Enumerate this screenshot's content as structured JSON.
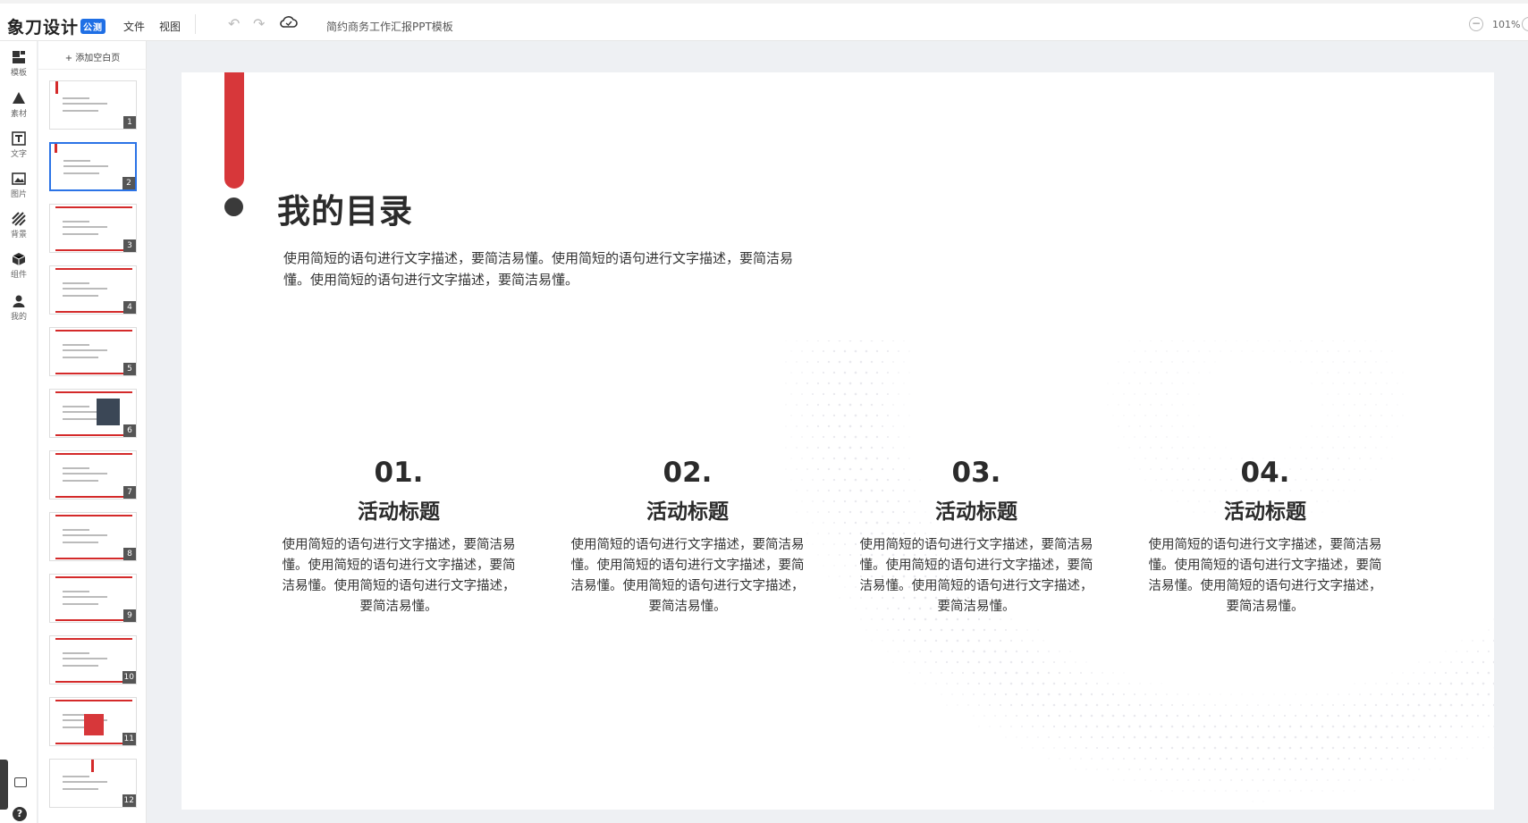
{
  "app": {
    "logo": "象刀设计",
    "logo_badge": "公测",
    "menu": [
      "文件",
      "视图"
    ],
    "doc_title": "简约商务工作汇报PPT模板",
    "zoom": "101%"
  },
  "rail": [
    {
      "label": "模板",
      "icon": "template-icon"
    },
    {
      "label": "素材",
      "icon": "shapes-icon"
    },
    {
      "label": "文字",
      "icon": "text-icon"
    },
    {
      "label": "图片",
      "icon": "image-icon"
    },
    {
      "label": "背景",
      "icon": "background-icon"
    },
    {
      "label": "组件",
      "icon": "component-icon"
    },
    {
      "label": "我的",
      "icon": "user-icon"
    }
  ],
  "panel": {
    "add_page": "+ 添加空白页",
    "slides": [
      "1",
      "2",
      "3",
      "4",
      "5",
      "6",
      "7",
      "8",
      "9",
      "10",
      "11",
      "12"
    ],
    "active_index": 2
  },
  "slide": {
    "title": "我的目录",
    "desc": "使用简短的语句进行文字描述，要简洁易懂。使用简短的语句进行文字描述，要简洁易懂。使用简短的语句进行文字描述，要简洁易懂。",
    "items": [
      {
        "num": "01.",
        "title": "活动标题",
        "text": "使用简短的语句进行文字描述，要简洁易懂。使用简短的语句进行文字描述，要简洁易懂。使用简短的语句进行文字描述，要简洁易懂。"
      },
      {
        "num": "02.",
        "title": "活动标题",
        "text": "使用简短的语句进行文字描述，要简洁易懂。使用简短的语句进行文字描述，要简洁易懂。使用简短的语句进行文字描述，要简洁易懂。"
      },
      {
        "num": "03.",
        "title": "活动标题",
        "text": "使用简短的语句进行文字描述，要简洁易懂。使用简短的语句进行文字描述，要简洁易懂。使用简短的语句进行文字描述，要简洁易懂。"
      },
      {
        "num": "04.",
        "title": "活动标题",
        "text": "使用简短的语句进行文字描述，要简洁易懂。使用简短的语句进行文字描述，要简洁易懂。使用简短的语句进行文字描述，要简洁易懂。"
      }
    ]
  },
  "colors": {
    "accent": "#d7373a",
    "brand": "#1f6fe5",
    "active_border": "#2b73e6"
  }
}
